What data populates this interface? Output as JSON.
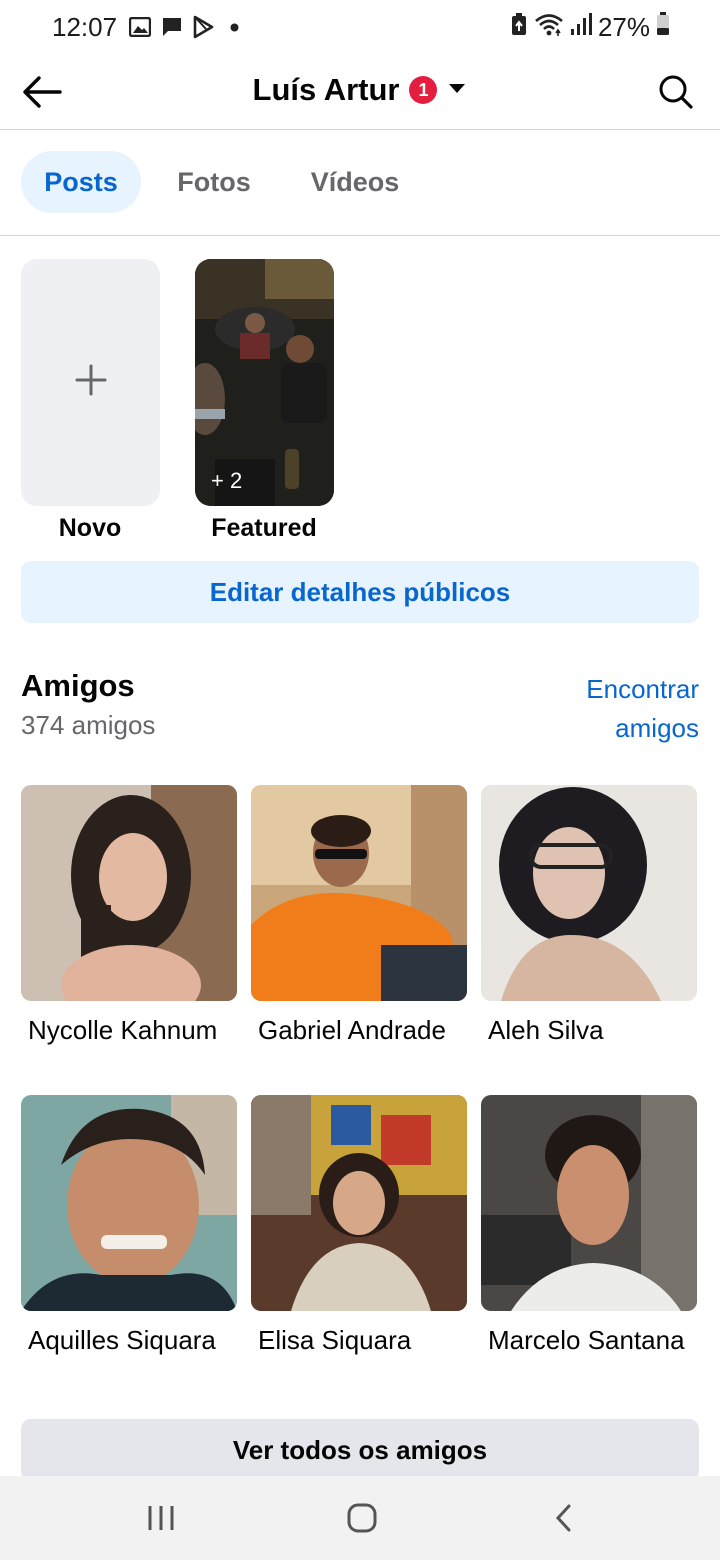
{
  "status_bar": {
    "time": "12:07",
    "battery": "27%",
    "icons": [
      "image-icon",
      "message-icon",
      "play-store-icon",
      "dot-icon",
      "battery-saver-icon",
      "wifi-icon",
      "signal-icon",
      "battery-icon"
    ]
  },
  "header": {
    "title": "Luís Artur",
    "badge_count": "1",
    "icons": [
      "back-arrow-icon",
      "dropdown-icon",
      "search-icon"
    ]
  },
  "tabs": [
    {
      "label": "Posts",
      "active": true
    },
    {
      "label": "Fotos",
      "active": false
    },
    {
      "label": "Vídeos",
      "active": false
    }
  ],
  "highlights": [
    {
      "label": "Novo",
      "icon": "plus-icon"
    },
    {
      "label": "Featured",
      "extra_count": "+ 2"
    }
  ],
  "edit_button": "Editar detalhes públicos",
  "friends": {
    "title": "Amigos",
    "count_text": "374 amigos",
    "find_link": "Encontrar amigos",
    "items": [
      {
        "name": "Nycolle Kahnum"
      },
      {
        "name": "Gabriel Andrade"
      },
      {
        "name": "Aleh Silva"
      },
      {
        "name": "Aquilles Siquara"
      },
      {
        "name": "Elisa Siquara"
      },
      {
        "name": "Marcelo Santana"
      }
    ],
    "see_all": "Ver todos os amigos"
  },
  "colors": {
    "accent": "#0866cf",
    "accent_bg": "#e7f3ff",
    "badge": "#e41e3f",
    "secondary_text": "#65676b"
  },
  "nav_bar": {
    "icons": [
      "recent-apps-icon",
      "home-icon",
      "back-icon"
    ]
  }
}
